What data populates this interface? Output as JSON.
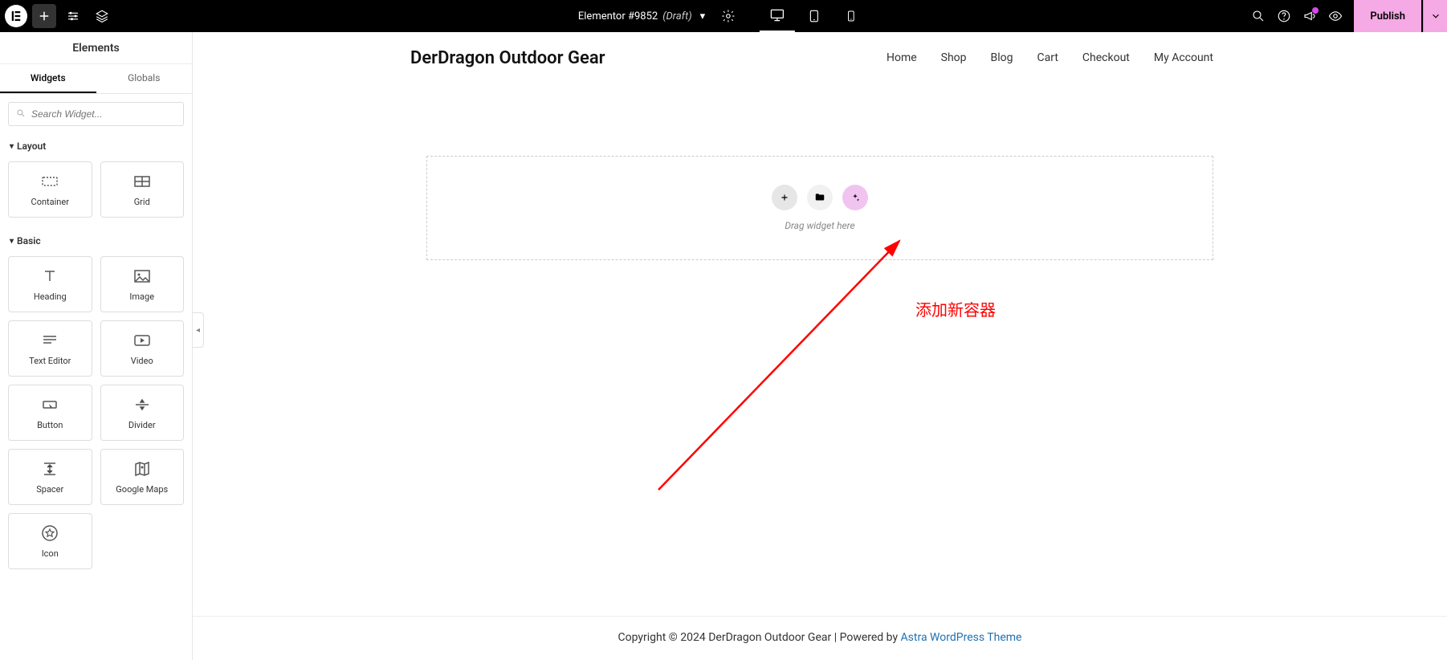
{
  "topbar": {
    "doc_title": "Elementor #9852",
    "doc_status": "(Draft)",
    "publish_label": "Publish"
  },
  "panel": {
    "header": "Elements",
    "tabs": {
      "widgets": "Widgets",
      "globals": "Globals"
    },
    "search_placeholder": "Search Widget...",
    "sections": {
      "layout": {
        "title": "Layout",
        "items": {
          "container": "Container",
          "grid": "Grid"
        }
      },
      "basic": {
        "title": "Basic",
        "items": {
          "heading": "Heading",
          "image": "Image",
          "text_editor": "Text Editor",
          "video": "Video",
          "button": "Button",
          "divider": "Divider",
          "spacer": "Spacer",
          "google_maps": "Google Maps",
          "icon": "Icon"
        }
      }
    }
  },
  "site": {
    "title": "DerDragon Outdoor Gear",
    "nav": {
      "home": "Home",
      "shop": "Shop",
      "blog": "Blog",
      "cart": "Cart",
      "checkout": "Checkout",
      "account": "My Account"
    }
  },
  "dropzone": {
    "hint": "Drag widget here"
  },
  "annotation": {
    "text": "添加新容器"
  },
  "footer": {
    "copyright": "Copyright © 2024 DerDragon Outdoor Gear | Powered by ",
    "theme_link": "Astra WordPress Theme"
  }
}
